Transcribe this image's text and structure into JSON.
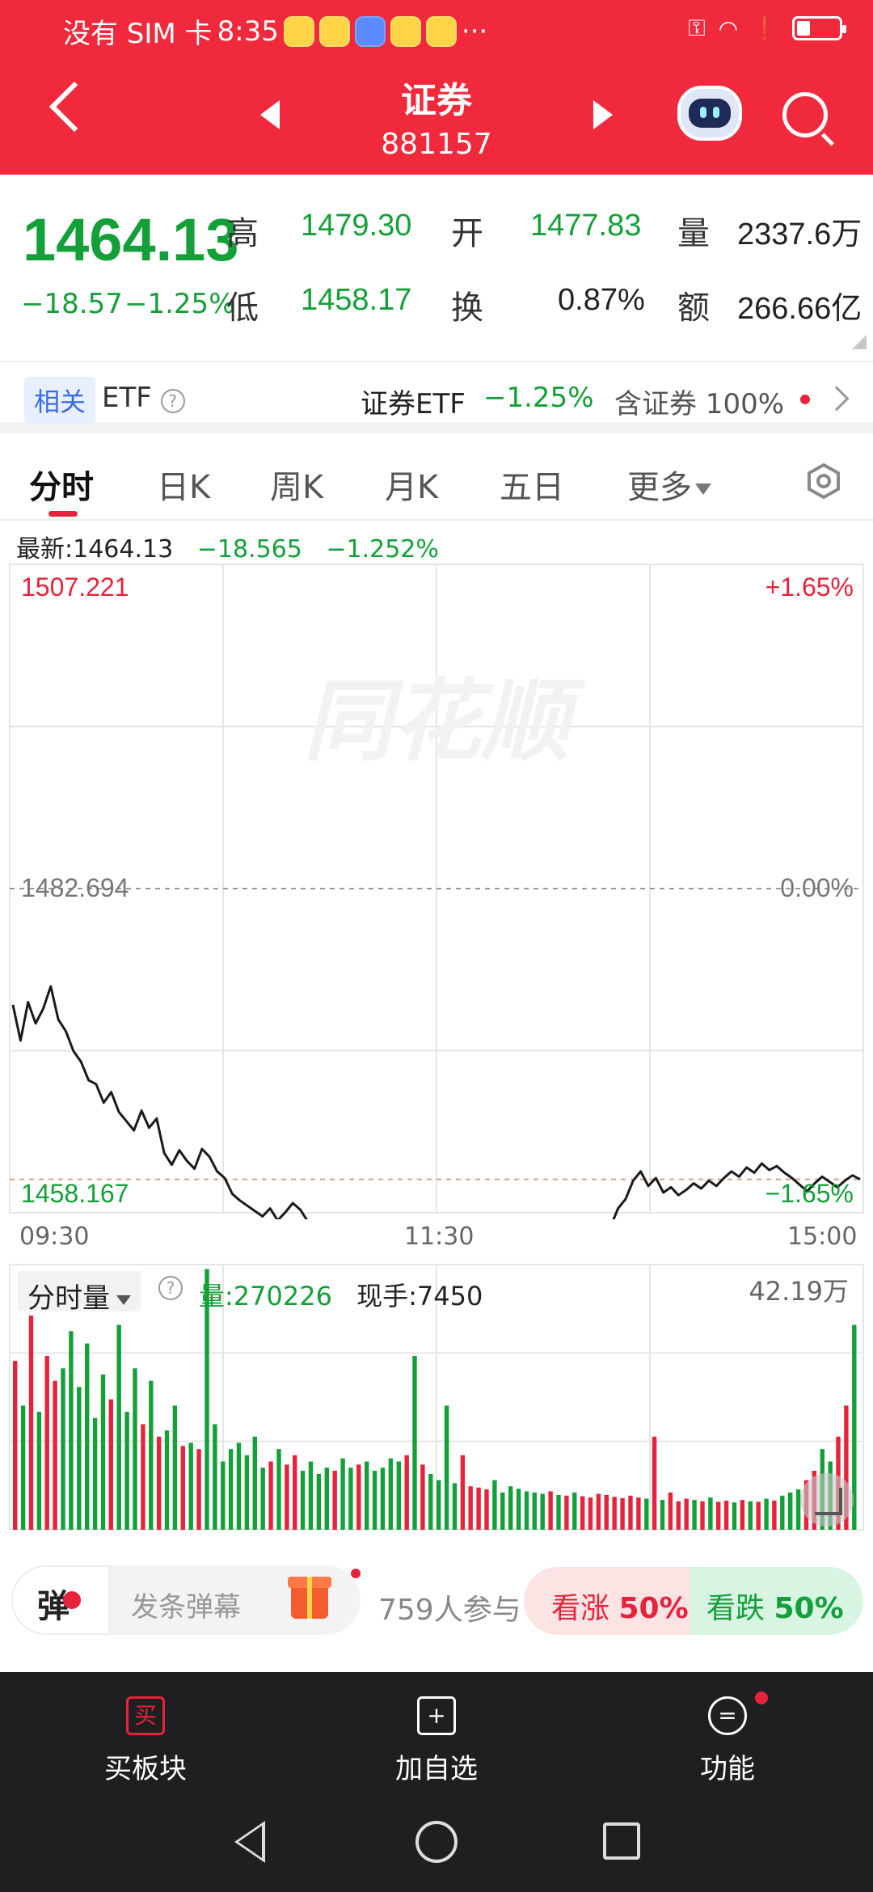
{
  "status_bar": {
    "carrier": "没有 SIM 卡",
    "time": "8:35",
    "more": "···"
  },
  "header": {
    "title": "证券",
    "code": "881157"
  },
  "quote": {
    "price": "1464.13",
    "change": "−18.57",
    "change_pct": "−1.25%",
    "high_label": "高",
    "high": "1479.30",
    "low_label": "低",
    "low": "1458.17",
    "open_label": "开",
    "open": "1477.83",
    "turnover_label": "换",
    "turnover": "0.87%",
    "volume_label": "量",
    "volume": "2337.6万",
    "amount_label": "额",
    "amount": "266.66亿"
  },
  "etf_bar": {
    "tag": "相关",
    "etf": "ETF",
    "help": "?",
    "name": "证券ETF",
    "pct": "−1.25%",
    "contains": "含证券 100%"
  },
  "tabs": [
    {
      "label": "分时"
    },
    {
      "label": "日K"
    },
    {
      "label": "周K"
    },
    {
      "label": "月K"
    },
    {
      "label": "五日"
    },
    {
      "label": "更多"
    }
  ],
  "latest": {
    "label": "最新:1464.13",
    "change": "−18.565",
    "pct": "−1.252%"
  },
  "chart_labels": {
    "top_price": "1507.221",
    "top_pct": "+1.65%",
    "mid_price": "1482.694",
    "mid_pct": "0.00%",
    "bottom_price": "1458.167",
    "bottom_pct": "−1.65%",
    "watermark": "同花顺"
  },
  "time_axis": [
    "09:30",
    "11:30",
    "15:00"
  ],
  "volume_panel": {
    "selector": "分时量",
    "help": "?",
    "volume": "量:270226",
    "current": "现手:7450",
    "max": "42.19万"
  },
  "chart_data": [
    {
      "type": "line",
      "title": "",
      "xlabel": "",
      "ylabel": "",
      "x_range": [
        "09:30",
        "15:00"
      ],
      "ylim": [
        1458.167,
        1507.221
      ],
      "reference": 1482.694,
      "values": [
        1473.9,
        1471.2,
        1474.1,
        1472.5,
        1473.6,
        1475.3,
        1472.8,
        1471.9,
        1470.4,
        1469.6,
        1468.2,
        1467.9,
        1466.5,
        1467.3,
        1465.8,
        1465.1,
        1464.4,
        1465.9,
        1464.6,
        1465.3,
        1462.7,
        1461.8,
        1462.9,
        1462.1,
        1461.5,
        1463.0,
        1462.4,
        1461.3,
        1460.8,
        1459.6,
        1459.1,
        1458.7,
        1458.3,
        1457.9,
        1458.5,
        1457.6,
        1458.2,
        1458.9,
        1458.4,
        1457.5,
        1457.1,
        1456.8,
        1456.4,
        1457.2,
        1456.9,
        1456.6,
        1457.4,
        1457.0,
        1456.3,
        1456.1,
        1455.9,
        1455.6,
        1456.2,
        1455.8,
        1456.6,
        1456.0,
        1455.4,
        1455.2,
        1455.0,
        1454.8,
        1455.2,
        1455.9,
        1456.4,
        1456.9,
        1456.5,
        1456.0,
        1455.6,
        1455.1,
        1454.8,
        1454.5,
        1454.2,
        1454.6,
        1454.3,
        1454.1,
        1454.5,
        1453.9,
        1454.6,
        1455.5,
        1456.7,
        1457.1,
        1458.5,
        1459.2,
        1460.6,
        1461.3,
        1460.2,
        1460.8,
        1459.7,
        1460.1,
        1459.5,
        1459.9,
        1460.4,
        1460.0,
        1460.6,
        1460.2,
        1460.8,
        1461.3,
        1460.9,
        1461.6,
        1461.2,
        1461.9,
        1461.4,
        1461.7,
        1461.2,
        1460.8,
        1460.3,
        1459.8,
        1460.4,
        1460.9,
        1460.5,
        1460.1,
        1460.6,
        1461.0,
        1460.7
      ],
      "series": [
        {
          "name": "",
          "color": "#1a1a1a"
        }
      ]
    },
    {
      "type": "bar",
      "title": "",
      "xlabel": "",
      "ylabel": "",
      "ylim": [
        0,
        421900
      ],
      "values": [
        272000,
        200000,
        345000,
        190000,
        280000,
        240000,
        260000,
        320000,
        230000,
        300000,
        180000,
        250000,
        210000,
        330000,
        190000,
        260000,
        170000,
        240000,
        150000,
        160000,
        200000,
        135000,
        140000,
        130000,
        420000,
        170000,
        110000,
        130000,
        140000,
        120000,
        150000,
        100000,
        110000,
        130000,
        105000,
        120000,
        95000,
        110000,
        90000,
        100000,
        95000,
        115000,
        100000,
        105000,
        110000,
        95000,
        100000,
        115000,
        110000,
        120000,
        280000,
        105000,
        90000,
        80000,
        200000,
        75000,
        120000,
        70000,
        68000,
        65000,
        80000,
        60000,
        70000,
        66000,
        62000,
        60000,
        58000,
        62000,
        56000,
        55000,
        60000,
        54000,
        52000,
        58000,
        56000,
        53000,
        51000,
        55000,
        52000,
        50000,
        150000,
        48000,
        60000,
        46000,
        50000,
        48000,
        46000,
        52000,
        45000,
        47000,
        44000,
        48000,
        46000,
        45000,
        50000,
        47000,
        55000,
        60000,
        65000,
        80000,
        95000,
        130000,
        110000,
        150000,
        200000,
        330000
      ],
      "up_color": "#e6233a",
      "down_color": "#14a038"
    }
  ],
  "danmaku": {
    "icon_char": "弹",
    "placeholder": "发条弹幕",
    "participants": "759人参与",
    "bull_label": "看涨",
    "bull_pct": "50%",
    "bear_label": "看跌",
    "bear_pct": "50%"
  },
  "bottom_bar": {
    "buy_icon": "买",
    "buy": "买板块",
    "add_icon": "+",
    "add": "加自选",
    "func_icon": "=",
    "func": "功能"
  },
  "colors": {
    "brand": "#f0293c",
    "up": "#e6233a",
    "down": "#14a038"
  }
}
